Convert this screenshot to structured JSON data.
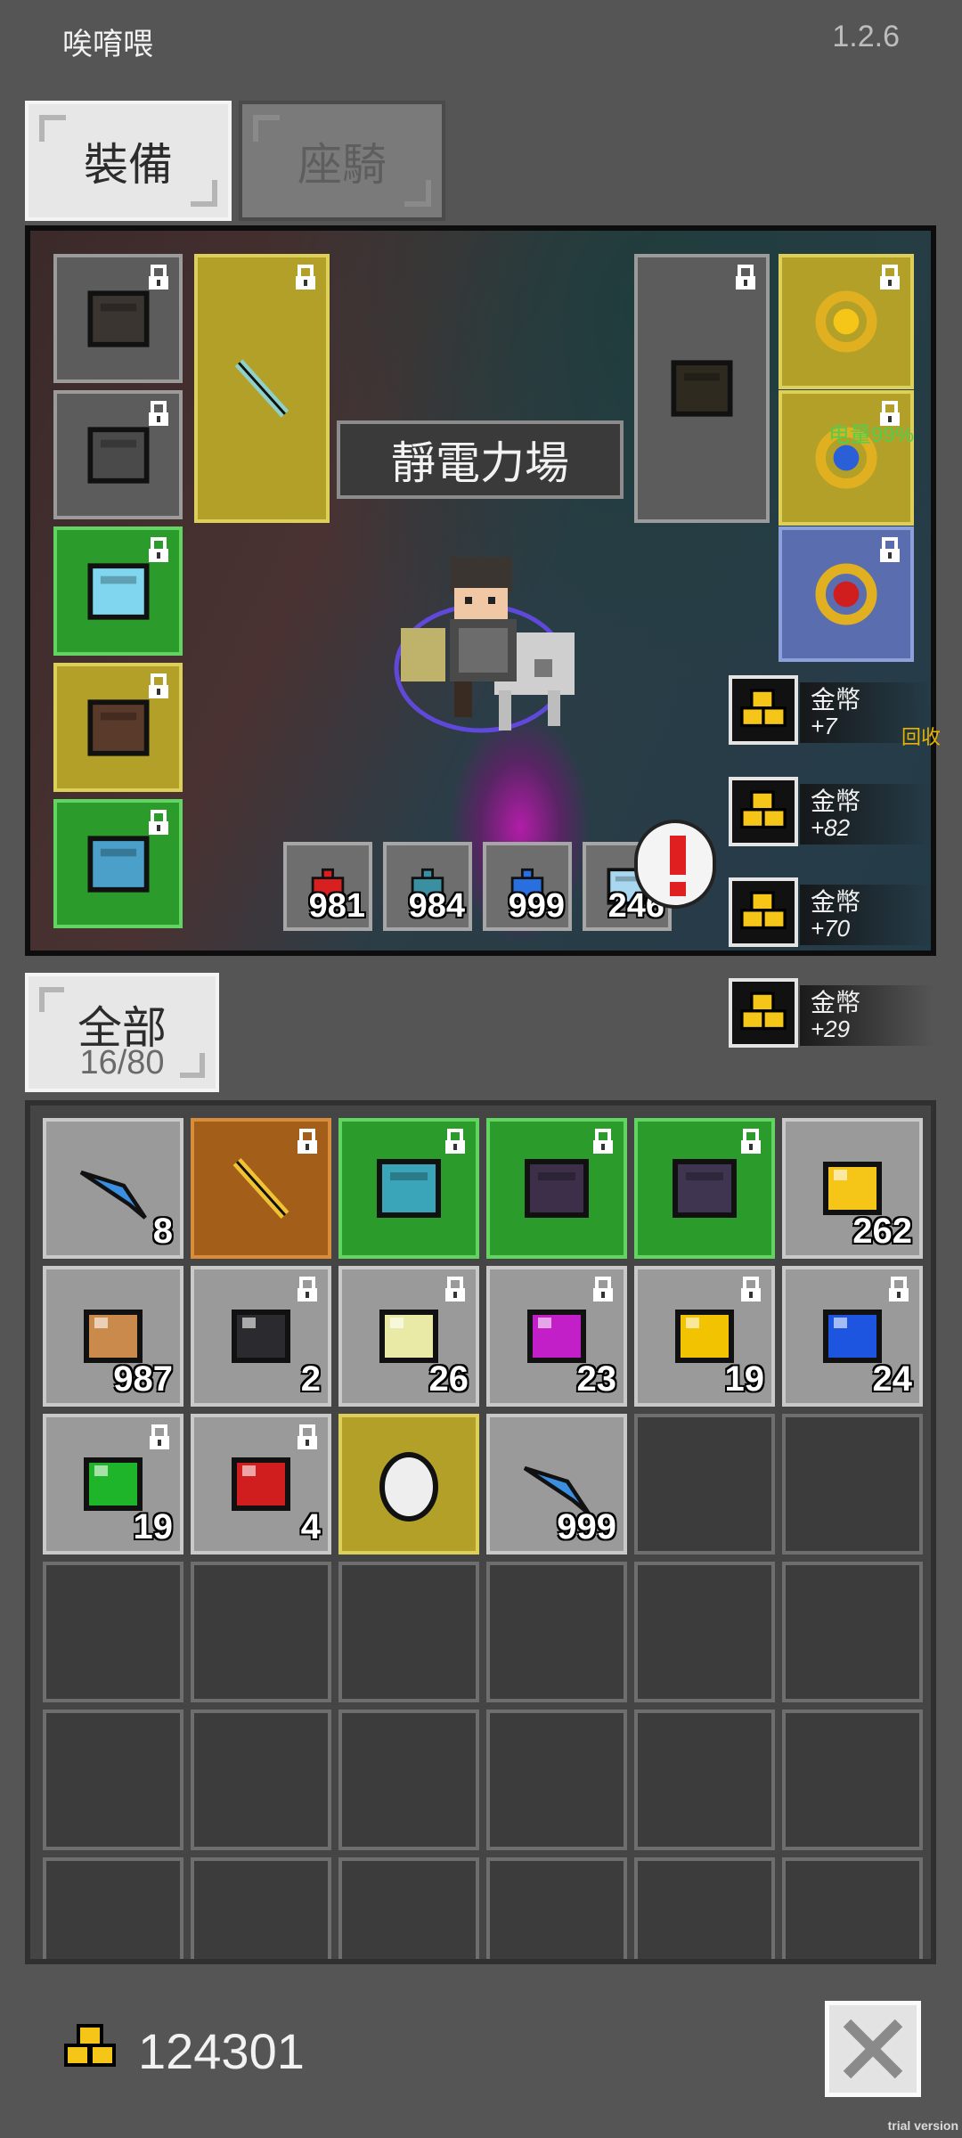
{
  "app": {
    "title": "唉唷喂",
    "version": "1.2.6"
  },
  "tabs": [
    {
      "label": "裝備",
      "active": true
    },
    {
      "label": "座騎",
      "active": false
    }
  ],
  "scene": {
    "skill_label": "靜電力場",
    "battery_text": "电量99%",
    "equipment_slots": [
      {
        "name": "helmet",
        "color": "gray",
        "locked": true
      },
      {
        "name": "armor",
        "color": "gray",
        "locked": true
      },
      {
        "name": "bracer",
        "color": "green",
        "locked": true
      },
      {
        "name": "boots",
        "color": "yellow",
        "locked": true
      },
      {
        "name": "belt",
        "color": "green",
        "locked": true
      },
      {
        "name": "weapon-wand",
        "color": "yellow",
        "locked": true
      },
      {
        "name": "shield",
        "color": "gray",
        "locked": true
      },
      {
        "name": "necklace",
        "color": "yellow",
        "locked": true
      },
      {
        "name": "ring-blue",
        "color": "yellow",
        "locked": true
      },
      {
        "name": "ring-red",
        "color": "blue",
        "locked": true
      }
    ],
    "consumables": [
      {
        "name": "red-potion",
        "qty": "981"
      },
      {
        "name": "teal-potion",
        "qty": "984"
      },
      {
        "name": "blue-potion",
        "qty": "999"
      },
      {
        "name": "scroll-book",
        "qty": "246"
      }
    ],
    "coin_notifications": [
      {
        "label": "金幣",
        "amount": "+7"
      },
      {
        "label": "金幣",
        "amount": "+82"
      },
      {
        "label": "金幣",
        "amount": "+70"
      },
      {
        "label": "金幣",
        "amount": "+29"
      }
    ],
    "recycle_label": "回收"
  },
  "filter": {
    "label": "全部",
    "count": "16/80"
  },
  "inventory": {
    "items": [
      {
        "name": "blue-feather",
        "color": "lgray",
        "qty": "8",
        "locked": false
      },
      {
        "name": "golden-sword",
        "color": "orange",
        "qty": "",
        "locked": true
      },
      {
        "name": "teal-chainmail",
        "color": "green",
        "qty": "",
        "locked": true
      },
      {
        "name": "dark-pauldron",
        "color": "green",
        "qty": "",
        "locked": true
      },
      {
        "name": "dark-gauntlet",
        "color": "green",
        "qty": "",
        "locked": true
      },
      {
        "name": "gold-nugget",
        "color": "lgray",
        "qty": "262",
        "locked": false
      },
      {
        "name": "copper-ore",
        "color": "lgray",
        "qty": "987",
        "locked": false
      },
      {
        "name": "black-gem",
        "color": "lgray",
        "qty": "2",
        "locked": true
      },
      {
        "name": "pale-gem",
        "color": "lgray",
        "qty": "26",
        "locked": true
      },
      {
        "name": "purple-gem",
        "color": "lgray",
        "qty": "23",
        "locked": true
      },
      {
        "name": "yellow-gem",
        "color": "lgray",
        "qty": "19",
        "locked": true
      },
      {
        "name": "blue-gem",
        "color": "lgray",
        "qty": "24",
        "locked": true
      },
      {
        "name": "green-gem",
        "color": "lgray",
        "qty": "19",
        "locked": true
      },
      {
        "name": "red-gem",
        "color": "lgray",
        "qty": "4",
        "locked": true
      },
      {
        "name": "white-egg",
        "color": "yellow",
        "qty": "",
        "locked": false
      },
      {
        "name": "blue-feather",
        "color": "lgray",
        "qty": "999",
        "locked": false
      }
    ],
    "empty_slots": 20
  },
  "footer": {
    "gold": "124301"
  },
  "watermark": "trial version",
  "colors": {
    "background": "#555555",
    "slot_green": "#2b9b2b",
    "slot_yellow": "#b3a028",
    "slot_blue": "#5a6eaf",
    "slot_orange": "#a35f1a"
  }
}
